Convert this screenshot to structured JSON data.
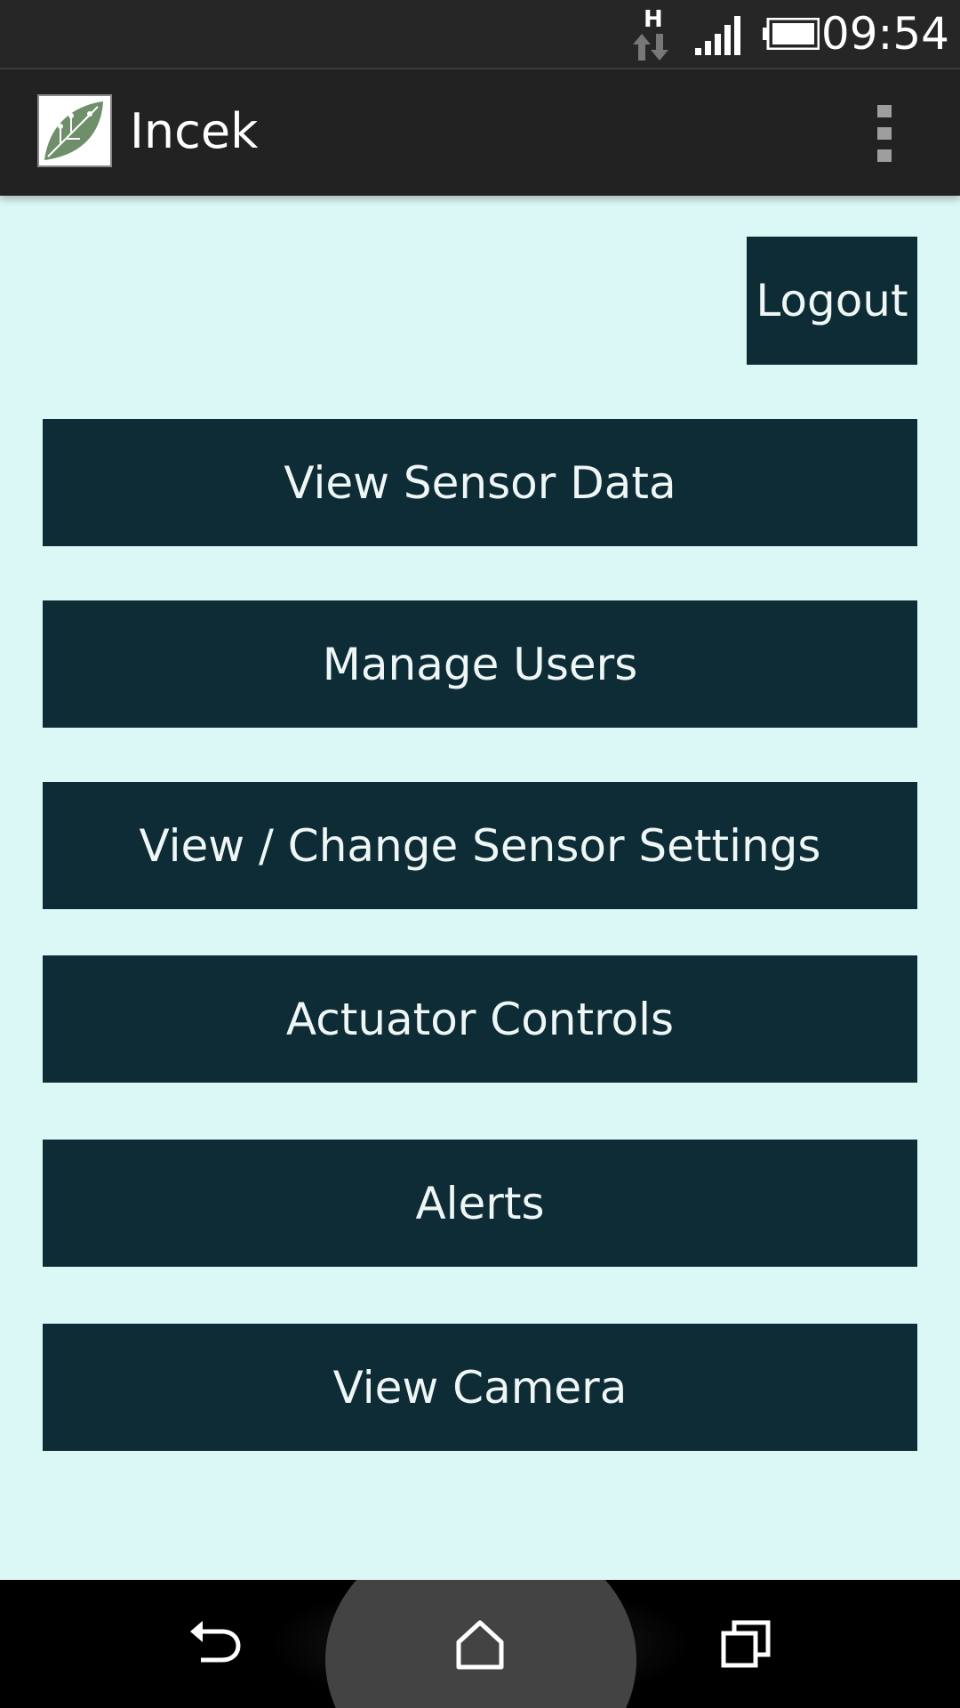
{
  "status_bar": {
    "network_type": "H",
    "time": "09:54"
  },
  "action_bar": {
    "title": "Incek",
    "overflow_icon": "overflow-menu-icon"
  },
  "main": {
    "logout_label": "Logout",
    "menu_buttons": [
      {
        "label": "View Sensor Data"
      },
      {
        "label": "Manage Users"
      },
      {
        "label": "View / Change Sensor Settings"
      },
      {
        "label": "Actuator Controls"
      },
      {
        "label": "Alerts"
      },
      {
        "label": "View Camera"
      }
    ]
  },
  "nav_bar": {
    "back_icon": "back-icon",
    "home_icon": "home-icon",
    "recents_icon": "recents-icon"
  },
  "colors": {
    "background": "#dbf7f6",
    "button": "#0e2c35",
    "action_bar": "#222222",
    "status_bar": "#262626"
  }
}
